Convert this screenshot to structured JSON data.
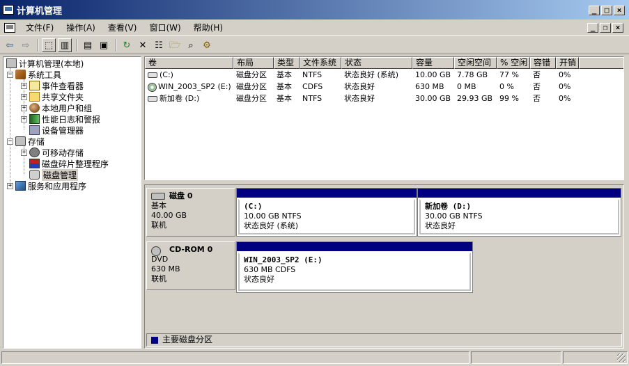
{
  "window": {
    "title": "计算机管理"
  },
  "menu": [
    "文件(F)",
    "操作(A)",
    "查看(V)",
    "窗口(W)",
    "帮助(H)"
  ],
  "caption_buttons": [
    "_",
    "□",
    "×"
  ],
  "mdi_buttons": [
    "_",
    "❐",
    "×"
  ],
  "toolbar": [
    {
      "icon": "back-arrow-icon",
      "glyph": "⇦"
    },
    {
      "icon": "forward-arrow-icon",
      "glyph": "⇨"
    },
    {
      "icon": "up-folder-icon",
      "glyph": "⬚"
    },
    {
      "icon": "show-hide-tree-icon",
      "glyph": "▥"
    },
    {
      "icon": "properties-icon",
      "glyph": "▤"
    },
    {
      "icon": "help-icon",
      "glyph": "▣"
    },
    {
      "icon": "refresh-icon",
      "glyph": "↻"
    },
    {
      "icon": "delete-icon",
      "glyph": "✕"
    },
    {
      "icon": "disk-properties-icon",
      "glyph": "☷"
    },
    {
      "icon": "open-folder-icon",
      "glyph": "🗁"
    },
    {
      "icon": "find-icon",
      "glyph": "⌕"
    },
    {
      "icon": "settings-icon",
      "glyph": "⚙"
    }
  ],
  "tree": {
    "root": "计算机管理(本地)",
    "system_tools": "系统工具",
    "event_viewer": "事件查看器",
    "shared_folders": "共享文件夹",
    "local_users": "本地用户和组",
    "perf_logs": "性能日志和警报",
    "device_manager": "设备管理器",
    "storage": "存储",
    "removable": "可移动存储",
    "defrag": "磁盘碎片整理程序",
    "disk_mgmt": "磁盘管理",
    "services": "服务和应用程序"
  },
  "volume_table": {
    "columns": [
      "卷",
      "布局",
      "类型",
      "文件系统",
      "状态",
      "容量",
      "空闲空间",
      "% 空闲",
      "容错",
      "开销"
    ],
    "rows": [
      {
        "vol": "(C:)",
        "layout": "磁盘分区",
        "type": "基本",
        "fs": "NTFS",
        "status": "状态良好 (系统)",
        "capacity": "10.00 GB",
        "free": "7.78 GB",
        "pct": "77 %",
        "ft": "否",
        "overhead": "0%",
        "icon": "hard-drive-icon"
      },
      {
        "vol": "WIN_2003_SP2 (E:)",
        "layout": "磁盘分区",
        "type": "基本",
        "fs": "CDFS",
        "status": "状态良好",
        "capacity": "630 MB",
        "free": "0 MB",
        "pct": "0 %",
        "ft": "否",
        "overhead": "0%",
        "icon": "cd-icon"
      },
      {
        "vol": "新加卷 (D:)",
        "layout": "磁盘分区",
        "type": "基本",
        "fs": "NTFS",
        "status": "状态良好",
        "capacity": "30.00 GB",
        "free": "29.93 GB",
        "pct": "99 %",
        "ft": "否",
        "overhead": "0%",
        "icon": "hard-drive-icon"
      }
    ]
  },
  "disks": [
    {
      "name": "磁盘 0",
      "type": "基本",
      "size": "40.00 GB",
      "state": "联机",
      "partitions": [
        {
          "name": "(C:)",
          "info": "10.00 GB NTFS",
          "status": "状态良好 (系统)"
        },
        {
          "name": "新加卷  (D:)",
          "info": "30.00 GB NTFS",
          "status": "状态良好"
        }
      ]
    },
    {
      "name": "CD-ROM 0",
      "type": "DVD",
      "size": "630 MB",
      "state": "联机",
      "partitions": [
        {
          "name": "WIN_2003_SP2  (E:)",
          "info": "630 MB CDFS",
          "status": "状态良好"
        }
      ]
    }
  ],
  "legend": {
    "label": "主要磁盘分区",
    "color": "#000080"
  },
  "colors": {
    "title_start": "#0a246a",
    "title_end": "#a6caf0",
    "partition_bar": "#000080",
    "face": "#d4d0c8"
  }
}
